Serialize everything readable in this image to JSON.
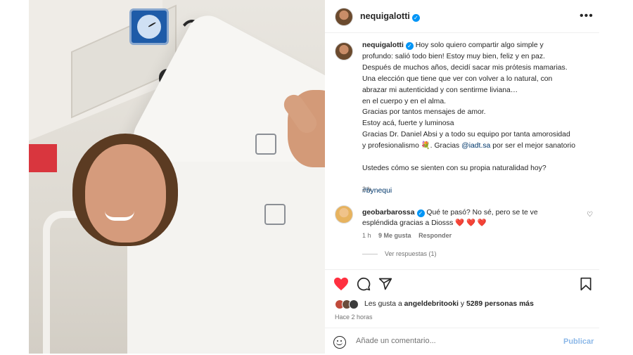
{
  "post": {
    "author": "nequigalotti",
    "verified_icon": "verified-badge-icon",
    "more_label": "•••",
    "caption_author": "nequigalotti",
    "caption_lines": [
      "Hoy solo quiero compartir algo simple y",
      "profundo: salió todo bien! Estoy muy bien, feliz y en paz.",
      "Después de muchos años, decidí sacar mis prótesis mamarias.",
      "Una elección que tiene que ver con volver a lo natural, con",
      "abrazar mi autenticidad y con sentirme liviana…",
      "en el cuerpo y en el alma.",
      "Gracias por tantos mensajes de amor.",
      "Estoy acá, fuerte y luminosa",
      "Gracias Dr. Daniel Absi y a todo su equipo por tanta amorosidad"
    ],
    "caption_last_prefix": "y profesionalismo 💐. Gracias ",
    "caption_mention": "@iadt.sa",
    "caption_last_suffix": " por ser el mejor sanatorio",
    "caption_question": "Ustedes cómo se sienten con su propia naturalidad hoy?",
    "hashtag": "#bynequi",
    "time": "2 h"
  },
  "comment": {
    "author": "geobarbarossa",
    "text_line1": "Qué te pasó? No sé, pero se te ve",
    "text_line2": "espléndida gracias a Diosss ❤️ ❤️ ❤️",
    "time": "1 h",
    "likes": "9 Me gusta",
    "reply": "Responder",
    "view_replies": "Ver respuestas (1)"
  },
  "actions": {
    "like_icon": "heart-filled-icon",
    "comment_icon": "comment-bubble-icon",
    "share_icon": "send-icon",
    "save_icon": "bookmark-icon",
    "like_color": "#ff3040"
  },
  "likes": {
    "prefix": "Les gusta a ",
    "user": "angeldebritooki",
    "middle": " y ",
    "count": "5289 personas más"
  },
  "posted_ago": "Hace 2 horas",
  "add_comment": {
    "placeholder": "Añade un comentario...",
    "publish": "Publicar",
    "emoji_icon": "emoji-smile-icon"
  },
  "colors": {
    "verified": "#0095f6",
    "link": "#00376b",
    "muted": "#737373",
    "publish_disabled": "#8cb8e8"
  }
}
